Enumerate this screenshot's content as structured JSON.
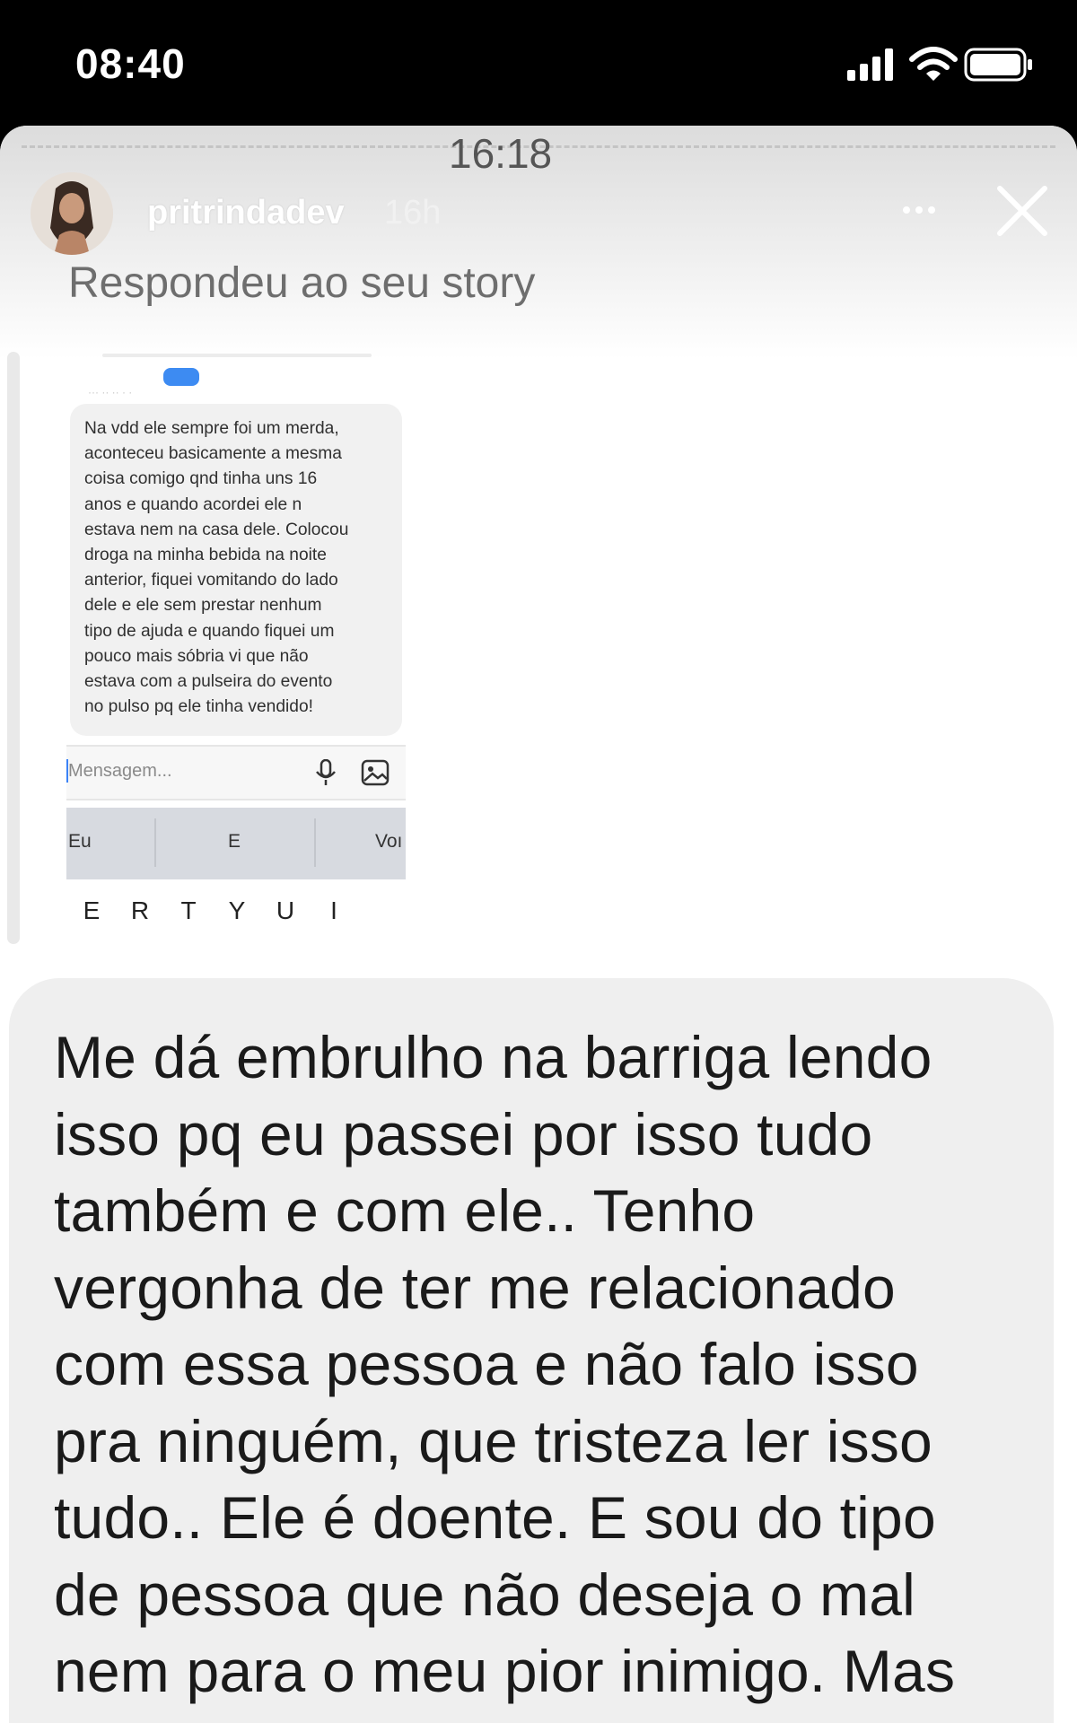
{
  "status_bar": {
    "time": "08:40",
    "icons": [
      "signal-icon",
      "wifi-icon",
      "battery-icon"
    ]
  },
  "story": {
    "overlay_time": "16:18",
    "username": "pritrindadev",
    "time_ago": "16h",
    "more_icon": "ellipsis-icon",
    "close_icon": "close-icon",
    "reply_label": "Respondeu ao seu story"
  },
  "screenshot": {
    "message_lines": [
      "Na vdd ele sempre foi um merda,",
      "aconteceu basicamente a mesma",
      "coisa comigo qnd tinha uns 16",
      "anos e quando acordei ele n",
      "estava nem na casa dele. Colocou",
      "droga na minha bebida na noite",
      "anterior, fiquei vomitando do lado",
      "dele e ele sem prestar nenhum",
      "tipo de ajuda e quando fiquei um",
      "pouco mais sóbria vi que não",
      "estava com a pulseira do evento",
      "no pulso pq ele tinha vendido!"
    ],
    "input_placeholder": "Mensagem...",
    "suggestions": [
      "Eu",
      "E",
      "Voı"
    ],
    "keys": [
      "E",
      "R",
      "T",
      "Y",
      "U",
      "I"
    ]
  },
  "reply_message": {
    "lines": [
      "Me dá embrulho na barriga lendo",
      "isso pq eu passei por isso tudo",
      "também e com ele.. Tenho",
      "vergonha de ter me relacionado",
      "com essa pessoa e não falo isso",
      "pra ninguém, que tristeza ler isso",
      "tudo.. Ele é doente. E sou do tipo",
      "de pessoa que não deseja o mal",
      "nem para o meu pior inimigo. Mas"
    ]
  },
  "colors": {
    "status_bg": "#000000",
    "story_bg": "#ffffff",
    "bubble_bg": "#efefef",
    "accent_blue": "#3d8bf2"
  }
}
